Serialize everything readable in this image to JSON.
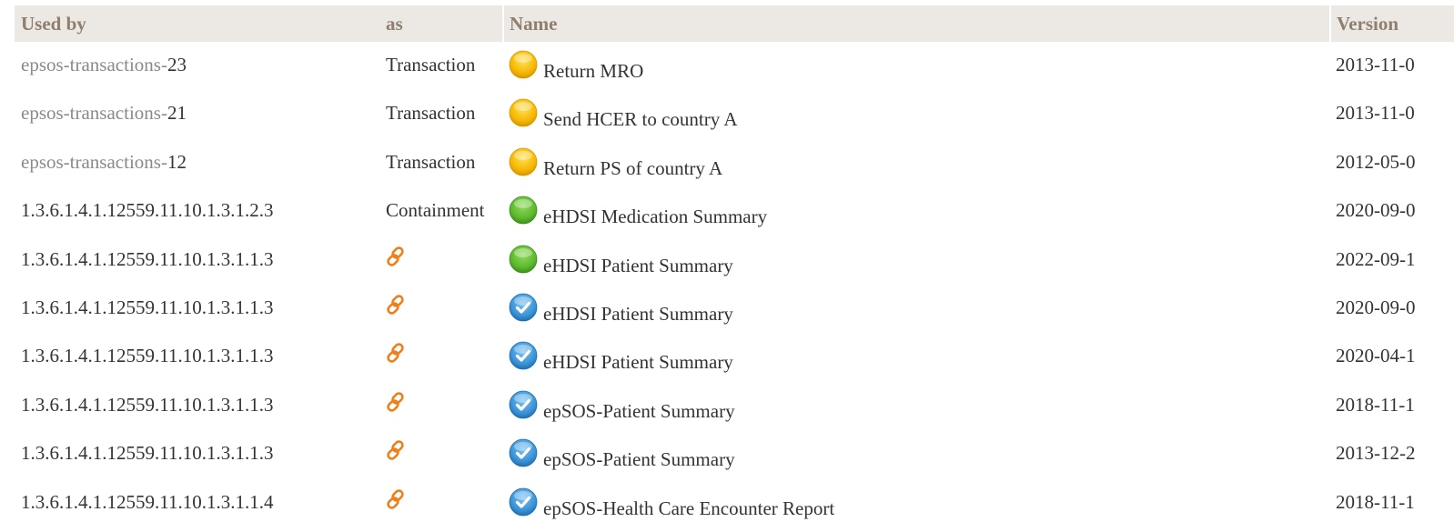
{
  "headers": {
    "used_by": "Used by",
    "as": "as",
    "name": "Name",
    "version": "Version"
  },
  "colors": {
    "header_bg": "#ece9e4",
    "header_text": "#8e7f6f",
    "link_prefix": "#8a8a8a",
    "status_draft": "#f5b800",
    "status_active": "#5cb82e",
    "status_final": "#3a93d6",
    "link_icon": "#f07f1a"
  },
  "rows": [
    {
      "id_prefix": "epsos-transactions-",
      "id_suffix": "23",
      "as": "Transaction",
      "status_icon": "yellow-circle-icon",
      "name": "Return MRO",
      "version": "2013-11-0"
    },
    {
      "id_prefix": "epsos-transactions-",
      "id_suffix": "21",
      "as": "Transaction",
      "status_icon": "yellow-circle-icon",
      "name": "Send HCER to country A",
      "version": "2013-11-0"
    },
    {
      "id_prefix": "epsos-transactions-",
      "id_suffix": "12",
      "as": "Transaction",
      "status_icon": "yellow-circle-icon",
      "name": "Return PS of country A",
      "version": "2012-05-0"
    },
    {
      "id_prefix": "",
      "id_suffix": "1.3.6.1.4.1.12559.11.10.1.3.1.2.3",
      "as": "Containment",
      "status_icon": "green-circle-icon",
      "name": "eHDSI Medication Summary",
      "version": "2020-09-0"
    },
    {
      "id_prefix": "",
      "id_suffix": "1.3.6.1.4.1.12559.11.10.1.3.1.1.3",
      "as": "",
      "as_icon": "link-icon",
      "status_icon": "green-circle-icon",
      "name": "eHDSI Patient Summary",
      "version": "2022-09-1"
    },
    {
      "id_prefix": "",
      "id_suffix": "1.3.6.1.4.1.12559.11.10.1.3.1.1.3",
      "as": "",
      "as_icon": "link-icon",
      "status_icon": "blue-check-icon",
      "name": "eHDSI Patient Summary",
      "version": "2020-09-0"
    },
    {
      "id_prefix": "",
      "id_suffix": "1.3.6.1.4.1.12559.11.10.1.3.1.1.3",
      "as": "",
      "as_icon": "link-icon",
      "status_icon": "blue-check-icon",
      "name": "eHDSI Patient Summary",
      "version": "2020-04-1"
    },
    {
      "id_prefix": "",
      "id_suffix": "1.3.6.1.4.1.12559.11.10.1.3.1.1.3",
      "as": "",
      "as_icon": "link-icon",
      "status_icon": "blue-check-icon",
      "name": "epSOS-Patient Summary",
      "version": "2018-11-1"
    },
    {
      "id_prefix": "",
      "id_suffix": "1.3.6.1.4.1.12559.11.10.1.3.1.1.3",
      "as": "",
      "as_icon": "link-icon",
      "status_icon": "blue-check-icon",
      "name": "epSOS-Patient Summary",
      "version": "2013-12-2"
    },
    {
      "id_prefix": "",
      "id_suffix": "1.3.6.1.4.1.12559.11.10.1.3.1.1.4",
      "as": "",
      "as_icon": "link-icon",
      "status_icon": "blue-check-icon",
      "name": "epSOS-Health Care Encounter Report",
      "version": "2018-11-1"
    }
  ]
}
